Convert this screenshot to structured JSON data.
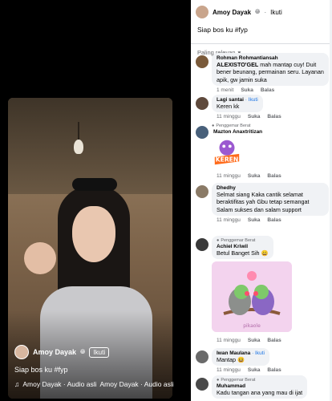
{
  "video": {
    "author": "Amoy Dayak",
    "follow_label": "Ikuti",
    "caption": "Siap bos ku #fyp",
    "audio_text": "Amoy Dayak · Audio asli",
    "audio_text_repeat": "Amoy Dayak · Audio asli"
  },
  "post": {
    "author": "Amoy Dayak",
    "separator": "·",
    "follow_label": "Ikuti",
    "caption": "Siap bos ku #fyp",
    "sort_label": "Paling relevan"
  },
  "comments": [
    {
      "author": "Rohman Rohmantiansah",
      "mention": "ALEXISTO'GEL",
      "text": " mah mantap cuy! Duit bener beunang, permainan seru. Layanan apik, gw jamin suka",
      "time": "1 menit",
      "like": "Suka",
      "reply": "Balas",
      "avatar_color": "#7a5a3a"
    },
    {
      "author": "Lagi santai",
      "tag": "· Ikuti",
      "text": "Keren kk",
      "time": "11 minggu",
      "like": "Suka",
      "reply": "Balas",
      "avatar_color": "#5f4a3c"
    },
    {
      "badge": "Penggemar Berat",
      "author": "Mazton Anaxtritizan",
      "sticker": "keren-sticker",
      "sticker_text": "KEREN",
      "time": "11 minggu",
      "like": "Suka",
      "reply": "Balas",
      "avatar_color": "#48607a"
    },
    {
      "author": "Dhedhy",
      "text": "Selmat siang Kaka cantik selamat beraktifitas yah Gbu tetap semangat Salam sukses dan salam support",
      "time": "11 minggu",
      "like": "Suka",
      "reply": "Balas",
      "avatar_color": "#8a7a66"
    },
    {
      "badge": "Penggemar Berat",
      "author": "Achiel Kriwil",
      "text": "Betul Banget Sih 😄",
      "sticker": "lovebirds-sticker",
      "sticker_text": "pikaole",
      "time": "11 minggu",
      "like": "Suka",
      "reply": "Balas",
      "avatar_color": "#3a3a3a"
    },
    {
      "author": "Iwan Maulana",
      "tag": "· Ikuti",
      "text": "Mantap 😆",
      "time": "11 minggu",
      "like": "Suka",
      "reply": "Balas",
      "avatar_color": "#6a6a6a"
    },
    {
      "badge": "Penggemar Berat",
      "author": "Muhammad",
      "text": "Kadu tangan ana yang mau di ijat",
      "avatar_color": "#4a4a4a"
    }
  ],
  "colors": {
    "link_blue": "#1b74e4",
    "bubble_bg": "#f0f2f5",
    "muted": "#65676b"
  }
}
